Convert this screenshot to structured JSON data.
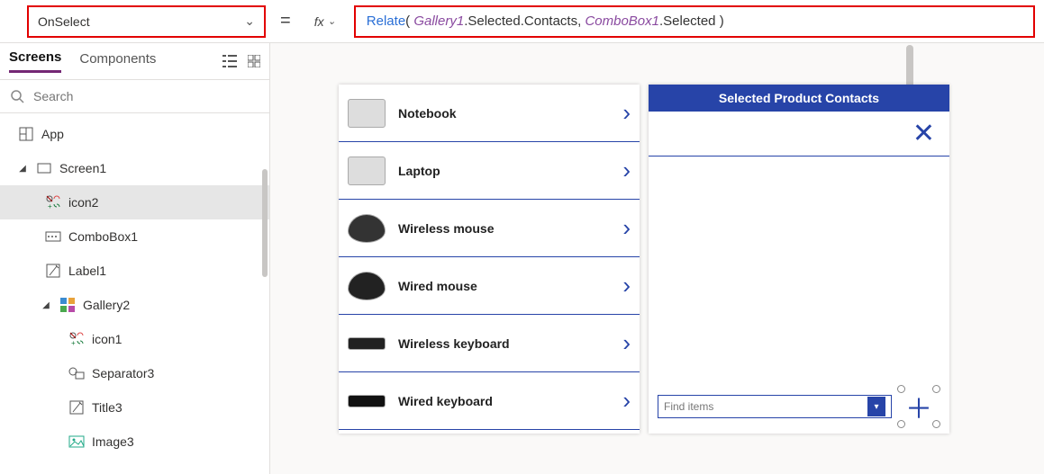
{
  "formula": {
    "property": "OnSelect",
    "fx_label": "fx",
    "tokens": {
      "fn": "Relate",
      "open": "( ",
      "id1": "Gallery1",
      "mem1": ".Selected.Contacts, ",
      "id2": "ComboBox1",
      "mem2": ".Selected ",
      "close": ")"
    }
  },
  "tree": {
    "tabs": {
      "screens": "Screens",
      "components": "Components"
    },
    "search_placeholder": "Search",
    "items": {
      "app": "App",
      "screen1": "Screen1",
      "icon2": "icon2",
      "combobox1": "ComboBox1",
      "label1": "Label1",
      "gallery2": "Gallery2",
      "icon1": "icon1",
      "separator3": "Separator3",
      "title3": "Title3",
      "image3": "Image3"
    }
  },
  "gallery": {
    "items": [
      {
        "title": "Notebook"
      },
      {
        "title": "Laptop"
      },
      {
        "title": "Wireless mouse"
      },
      {
        "title": "Wired mouse"
      },
      {
        "title": "Wireless keyboard"
      },
      {
        "title": "Wired keyboard"
      }
    ]
  },
  "right_panel": {
    "header": "Selected Product Contacts",
    "combo_placeholder": "Find items"
  }
}
